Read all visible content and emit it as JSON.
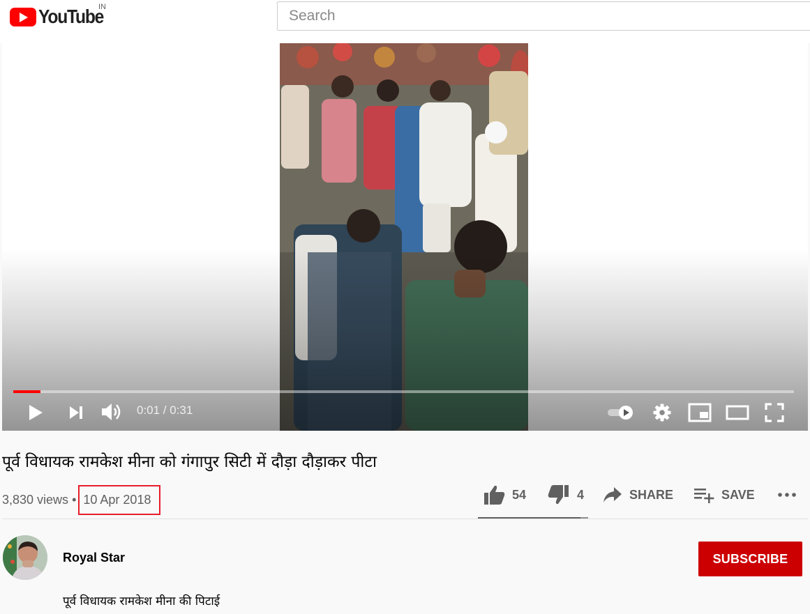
{
  "header": {
    "logo_text": "YouTube",
    "country_code": "IN",
    "search_placeholder": "Search"
  },
  "player": {
    "time_display": "0:01 / 0:31",
    "progress_fraction": 0.035,
    "colors": {
      "progress": "#ff0000"
    },
    "controls": [
      "play-icon",
      "next-icon",
      "volume-icon",
      "autoplay-toggle",
      "gear-icon",
      "miniplayer-icon",
      "theater-icon",
      "fullscreen-icon"
    ]
  },
  "video": {
    "title": "पूर्व विधायक रामकेश मीना को गंगापुर सिटी में दौड़ा दौड़ाकर पीटा",
    "views": "3,830 views",
    "separator": "•",
    "date": "10 Apr 2018",
    "likes": "54",
    "dislikes": "4",
    "share_label": "SHARE",
    "save_label": "SAVE",
    "like_ratio": 0.93
  },
  "channel": {
    "name": "Royal Star",
    "subscribe_label": "SUBSCRIBE",
    "description": "पूर्व विधायक रामकेश मीना की पिटाई",
    "colors": {
      "subscribe": "#cc0000",
      "date_highlight": "#e61e2a"
    }
  }
}
